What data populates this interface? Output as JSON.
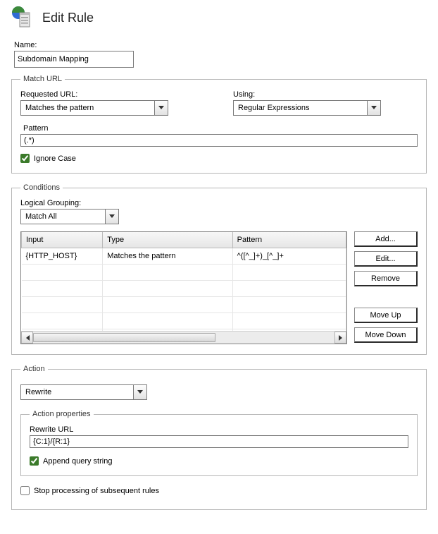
{
  "header": {
    "title": "Edit Rule"
  },
  "name": {
    "label": "Name:",
    "value": "Subdomain Mapping"
  },
  "match_url": {
    "legend": "Match URL",
    "requested_url_label": "Requested URL:",
    "requested_url_value": "Matches the pattern",
    "using_label": "Using:",
    "using_value": "Regular Expressions",
    "pattern_label": "Pattern",
    "pattern_value": "(.*)",
    "ignore_case_label": "Ignore Case",
    "ignore_case_checked": true
  },
  "conditions": {
    "legend": "Conditions",
    "logical_grouping_label": "Logical Grouping:",
    "logical_grouping_value": "Match All",
    "columns": {
      "input": "Input",
      "type": "Type",
      "pattern": "Pattern"
    },
    "rows": [
      {
        "input": "{HTTP_HOST}",
        "type": "Matches the pattern",
        "pattern": "^([^_]+)_[^_]+"
      }
    ],
    "buttons": {
      "add": "Add...",
      "edit": "Edit...",
      "remove": "Remove",
      "move_up": "Move Up",
      "move_down": "Move Down"
    }
  },
  "action": {
    "legend": "Action",
    "type_value": "Rewrite",
    "properties_legend": "Action properties",
    "rewrite_url_label": "Rewrite URL",
    "rewrite_url_value": "{C:1}/{R:1}",
    "append_qs_label": "Append query string",
    "append_qs_checked": true,
    "stop_processing_label": "Stop processing of subsequent rules",
    "stop_processing_checked": false
  }
}
